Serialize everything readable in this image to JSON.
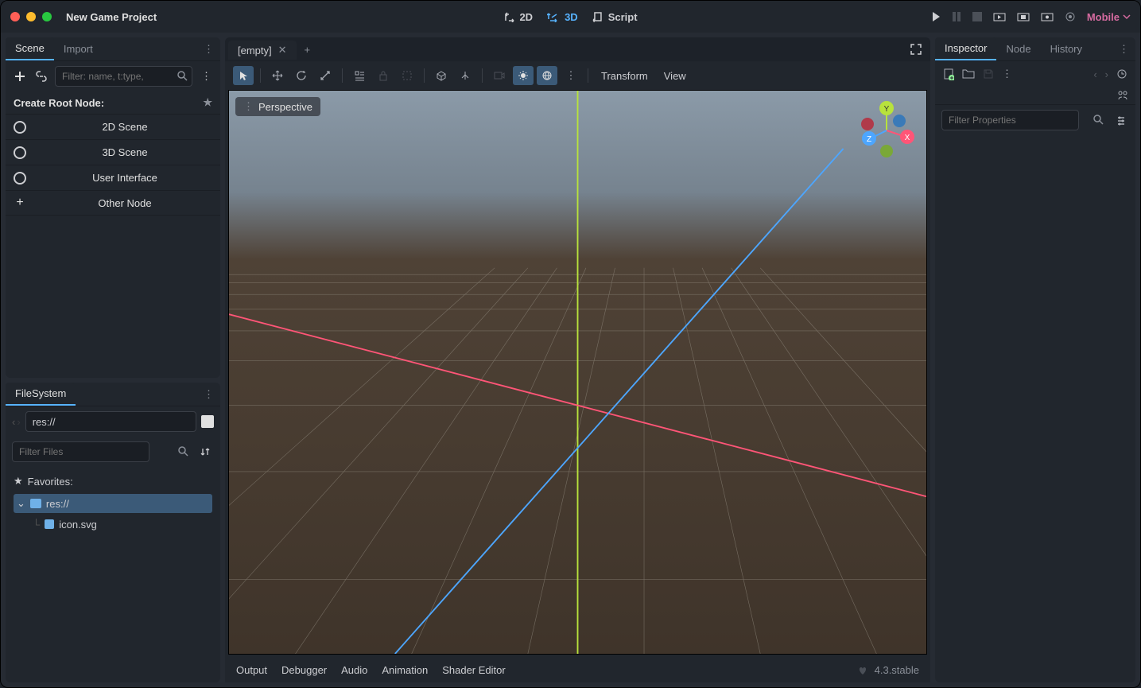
{
  "title": "New Game Project",
  "topmodes": {
    "d2": "2D",
    "d3": "3D",
    "script": "Script"
  },
  "renderer": "Mobile",
  "scene_dock": {
    "tabs": [
      "Scene",
      "Import"
    ],
    "filter_placeholder": "Filter: name, t:type,",
    "create_root": "Create Root Node:",
    "options": [
      "2D Scene",
      "3D Scene",
      "User Interface",
      "Other Node"
    ]
  },
  "filesystem": {
    "title": "FileSystem",
    "path": "res://",
    "filter_placeholder": "Filter Files",
    "favorites": "Favorites:",
    "root": "res://",
    "file": "icon.svg"
  },
  "viewport": {
    "tab": "[empty]",
    "perspective": "Perspective",
    "menus": [
      "Transform",
      "View"
    ]
  },
  "bottom": {
    "items": [
      "Output",
      "Debugger",
      "Audio",
      "Animation",
      "Shader Editor"
    ],
    "version": "4.3.stable"
  },
  "inspector": {
    "tabs": [
      "Inspector",
      "Node",
      "History"
    ],
    "filter_placeholder": "Filter Properties"
  }
}
